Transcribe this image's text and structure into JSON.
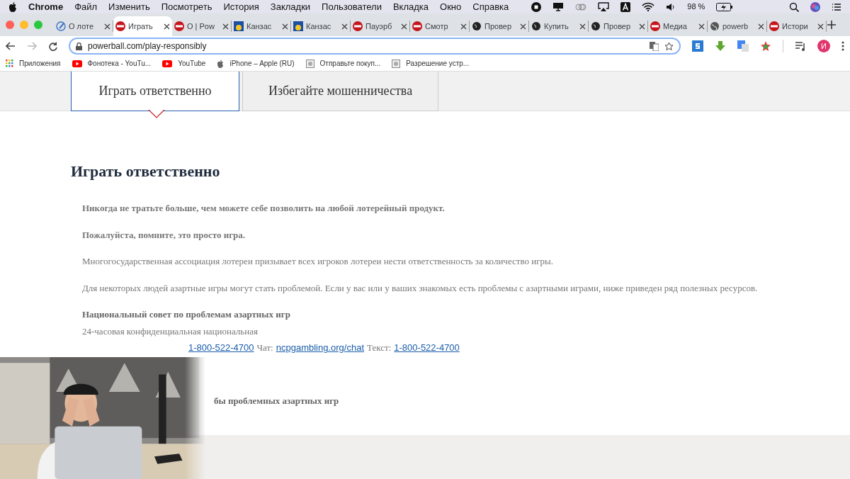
{
  "menu_bar": {
    "app": "Chrome",
    "items": [
      "Файл",
      "Изменить",
      "Посмотреть",
      "История",
      "Закладки",
      "Пользователи",
      "Вкладка",
      "Окно",
      "Справка"
    ],
    "battery_text": "98 %"
  },
  "tabs": [
    {
      "label": "О лоте",
      "kind": "pen",
      "selected": false
    },
    {
      "label": "Играть",
      "kind": "ball",
      "selected": true
    },
    {
      "label": "О | Pow",
      "kind": "ball",
      "selected": false
    },
    {
      "label": "Канзас",
      "kind": "flag",
      "selected": false
    },
    {
      "label": "Канзас",
      "kind": "flag",
      "selected": false
    },
    {
      "label": "Пауэрб",
      "kind": "ball",
      "selected": false
    },
    {
      "label": "Смотр",
      "kind": "ball",
      "selected": false
    },
    {
      "label": "Провер",
      "kind": "bulb",
      "selected": false
    },
    {
      "label": "Купить",
      "kind": "bulb",
      "selected": false
    },
    {
      "label": "Провер",
      "kind": "bulb",
      "selected": false
    },
    {
      "label": "Медиа",
      "kind": "ball",
      "selected": false
    },
    {
      "label": "powerb",
      "kind": "globe",
      "selected": false
    },
    {
      "label": "Истори",
      "kind": "ball",
      "selected": false
    }
  ],
  "address_bar": {
    "value": "powerball.com/play-responsibly"
  },
  "profile_initial": "И",
  "bookmarks": [
    {
      "label": "Приложения",
      "kind": "apps"
    },
    {
      "label": "Фонотека - YouTu...",
      "kind": "youtube"
    },
    {
      "label": "YouTube",
      "kind": "youtube"
    },
    {
      "label": "iPhone – Apple (RU)",
      "kind": "apple"
    },
    {
      "label": "Отправьте покуп...",
      "kind": "page"
    },
    {
      "label": "Разрешение устр...",
      "kind": "page"
    }
  ],
  "page_tabs": [
    {
      "label": "Играть ответственно",
      "selected": true
    },
    {
      "label": "Избегайте мошенничества",
      "selected": false
    }
  ],
  "heading": "Играть ответственно",
  "paragraphs": [
    {
      "text": "Никогда не тратьте больше, чем можете себе позволить на любой лотерейный продукт.",
      "bold": true
    },
    {
      "text": "Пожалуйста, помните, это просто игра.",
      "bold": true
    },
    {
      "text": "Многогосударственная ассоциация лотереи призывает всех игроков лотереи нести ответственность за количество игры.",
      "bold": false
    },
    {
      "text": "Для некоторых людей азартные игры могут стать проблемой. Если у вас или у ваших знакомых есть проблемы с азартными играми, ниже приведен ряд полезных ресурсов.",
      "bold": false
    }
  ],
  "resource": {
    "title": "Национальный совет по проблемам азартных игр",
    "line": "24-часовая конфиденциальная национальная",
    "contacts": [
      {
        "text": "1-800-522-4700",
        "kind": "link"
      },
      {
        "text": "Чат:",
        "kind": "label"
      },
      {
        "text": "ncpgambling.org/chat",
        "kind": "link"
      },
      {
        "text": "Текст:",
        "kind": "label"
      },
      {
        "text": "1-800-522-4700",
        "kind": "link"
      }
    ]
  },
  "partial_heading": "бы проблемных азартных игр"
}
